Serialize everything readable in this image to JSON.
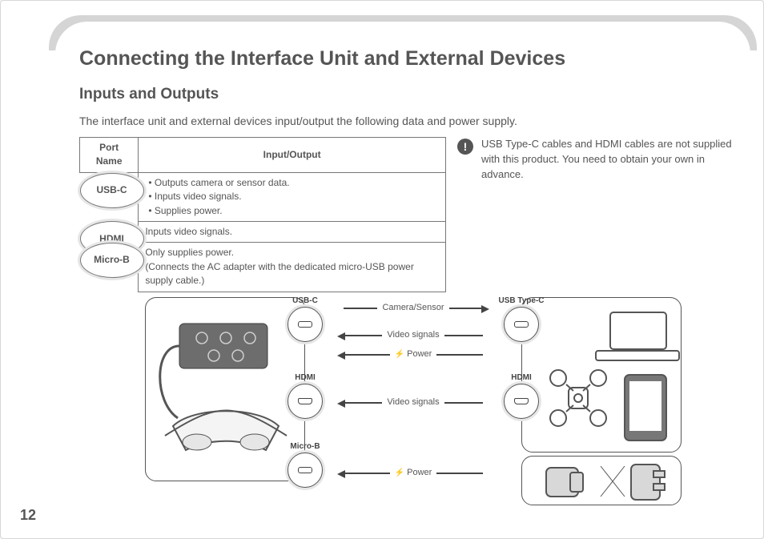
{
  "page_number": "12",
  "title": "Connecting the Interface Unit and External Devices",
  "subtitle": "Inputs and Outputs",
  "intro": "The interface unit and external devices input/output the following data and power supply.",
  "table": {
    "header_port": "Port Name",
    "header_io": "Input/Output",
    "rows": [
      {
        "port": "USB-C",
        "bullets": [
          "Outputs camera or sensor data.",
          "Inputs video signals.",
          "Supplies power."
        ]
      },
      {
        "port": "HDMI",
        "text": "Inputs video signals."
      },
      {
        "port": "Micro-B",
        "text": "Only supplies power.\n(Connects the AC adapter with the dedicated micro-USB power supply cable.)"
      }
    ]
  },
  "note": {
    "icon": "!",
    "text": "USB Type-C cables and HDMI cables are not supplied with this product. You need to obtain your own in advance."
  },
  "diagram": {
    "left_ports": {
      "usbc": "USB-C",
      "hdmi": "HDMI",
      "microb": "Micro-B"
    },
    "right_ports": {
      "usbc": "USB Type-C",
      "hdmi": "HDMI"
    },
    "arrows": {
      "camera": "Camera/Sensor",
      "video1": "Video signals",
      "power1": "Power",
      "video2": "Video signals",
      "power2": "Power"
    },
    "devices": {
      "interface_unit": "interface-unit",
      "headset": "headset",
      "laptop": "laptop",
      "drone": "drone",
      "tablet": "tablet",
      "adapter": "ac-adapter"
    }
  }
}
